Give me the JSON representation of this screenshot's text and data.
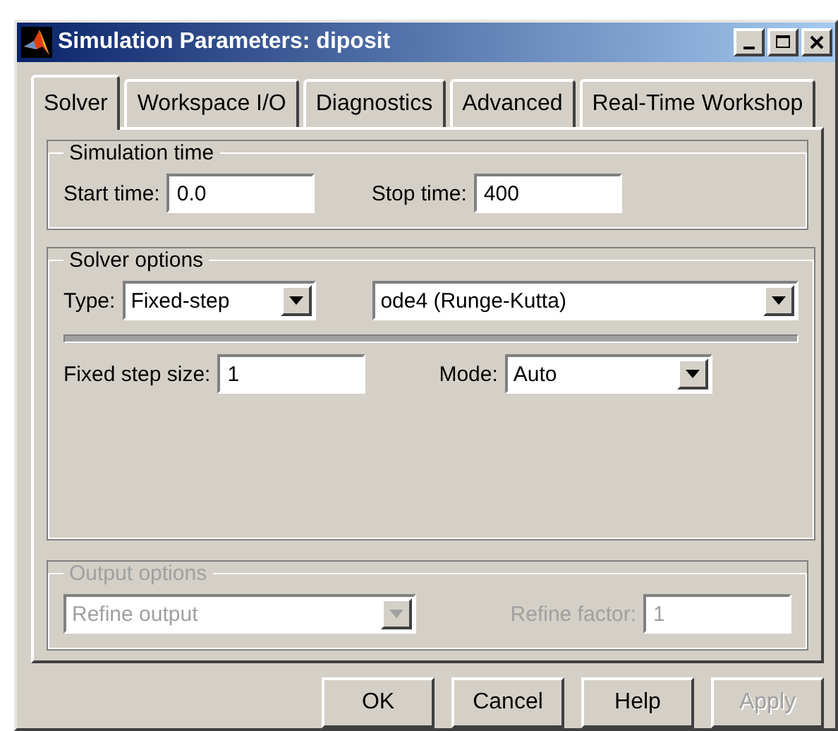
{
  "window": {
    "title": "Simulation Parameters: diposit"
  },
  "tabs": [
    {
      "label": "Solver",
      "selected": true
    },
    {
      "label": "Workspace I/O",
      "selected": false
    },
    {
      "label": "Diagnostics",
      "selected": false
    },
    {
      "label": "Advanced",
      "selected": false
    },
    {
      "label": "Real-Time Workshop",
      "selected": false
    }
  ],
  "simulation_time": {
    "title": "Simulation time",
    "start": {
      "label": "Start time:",
      "value": "0.0"
    },
    "stop": {
      "label": "Stop time:",
      "value": "400"
    }
  },
  "solver_options": {
    "title": "Solver options",
    "type": {
      "label": "Type:",
      "value": "Fixed-step"
    },
    "solver": {
      "value": "ode4 (Runge-Kutta)"
    },
    "step_size": {
      "label": "Fixed step size:",
      "value": "1"
    },
    "mode": {
      "label": "Mode:",
      "value": "Auto"
    }
  },
  "output_options": {
    "title": "Output options",
    "disabled": true,
    "refine": {
      "value": "Refine output"
    },
    "refine_factor": {
      "label": "Refine factor:",
      "value": "1"
    }
  },
  "buttons": [
    {
      "label": "OK",
      "disabled": false
    },
    {
      "label": "Cancel",
      "disabled": false
    },
    {
      "label": "Help",
      "disabled": false
    },
    {
      "label": "Apply",
      "disabled": true
    }
  ]
}
